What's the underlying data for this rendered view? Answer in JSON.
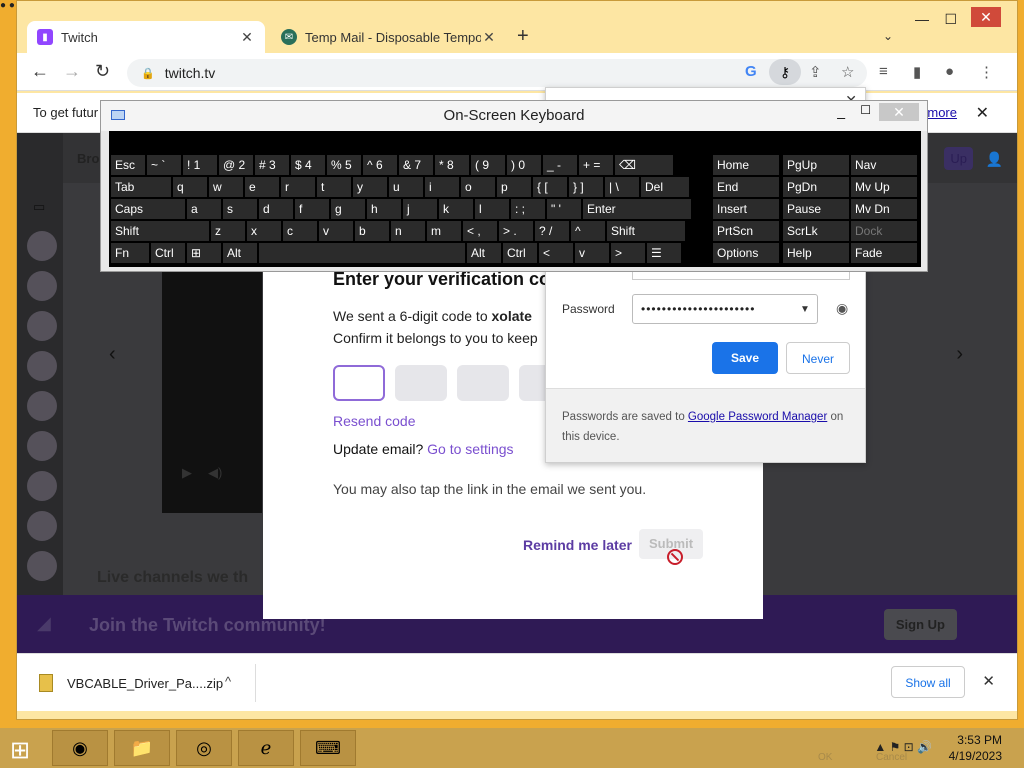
{
  "browser": {
    "tabs": [
      {
        "label": "Twitch",
        "favicon": "twitch-icon"
      },
      {
        "label": "Temp Mail - Disposable Tempora",
        "favicon": "tempmail-icon"
      }
    ],
    "url": "twitch.tv",
    "info_bar": {
      "text": "To get futur",
      "link": "more"
    }
  },
  "modal": {
    "title": "Enter your verification co",
    "desc_line1_pre": "We sent a 6-digit code to ",
    "desc_email": "xolate",
    "desc_line2": "Confirm it belongs to you to keep",
    "resend": "Resend code",
    "update_label": "Update email?",
    "update_link": "Go to settings",
    "note": "You may also tap the link in the email we sent you.",
    "remind": "Remind me later",
    "submit": "Submit"
  },
  "password_popup": {
    "password_label": "Password",
    "password_value": "••••••••••••••••••••••",
    "save": "Save",
    "never": "Never",
    "footer_pre": "Passwords are saved to ",
    "footer_link": "Google Password Manager",
    "footer_post": " on this device."
  },
  "osk": {
    "title": "On-Screen Keyboard",
    "rows": [
      [
        "Esc",
        "~ `",
        "! 1",
        "@ 2",
        "# 3",
        "$ 4",
        "% 5",
        "^ 6",
        "& 7",
        "* 8",
        "( 9",
        ") 0",
        "_ -",
        "+ =",
        "⌫"
      ],
      [
        "Tab",
        "q",
        "w",
        "e",
        "r",
        "t",
        "y",
        "u",
        "i",
        "o",
        "p",
        "{ [",
        "} ]",
        "| \\",
        "Del"
      ],
      [
        "Caps",
        "a",
        "s",
        "d",
        "f",
        "g",
        "h",
        "j",
        "k",
        "l",
        ": ;",
        "\" '",
        "Enter"
      ],
      [
        "Shift",
        "z",
        "x",
        "c",
        "v",
        "b",
        "n",
        "m",
        "< ,",
        "> .",
        "? /",
        "^",
        "Shift"
      ],
      [
        "Fn",
        "Ctrl",
        "⊞",
        "Alt",
        "",
        "Alt",
        "Ctrl",
        "<",
        "v",
        ">",
        "☰"
      ]
    ],
    "nav_keys": [
      [
        "Home",
        "PgUp",
        "Nav"
      ],
      [
        "End",
        "PgDn",
        "Mv Up"
      ],
      [
        "Insert",
        "Pause",
        "Mv Dn"
      ],
      [
        "PrtScn",
        "ScrLk",
        "Dock"
      ],
      [
        "Options",
        "Help",
        "Fade"
      ]
    ]
  },
  "page": {
    "live_heading": "Live channels we th",
    "join_text": "Join the Twitch community!",
    "signup": "Sign Up",
    "header_signup": "Up",
    "header_browse": "Bro"
  },
  "downloads": {
    "file": "VBCABLE_Driver_Pa....zip",
    "show_all": "Show all"
  },
  "taskbar": {
    "time": "3:53 PM",
    "date": "4/19/2023",
    "ghost_ok": "OK",
    "ghost_cancel": "Cancel"
  }
}
